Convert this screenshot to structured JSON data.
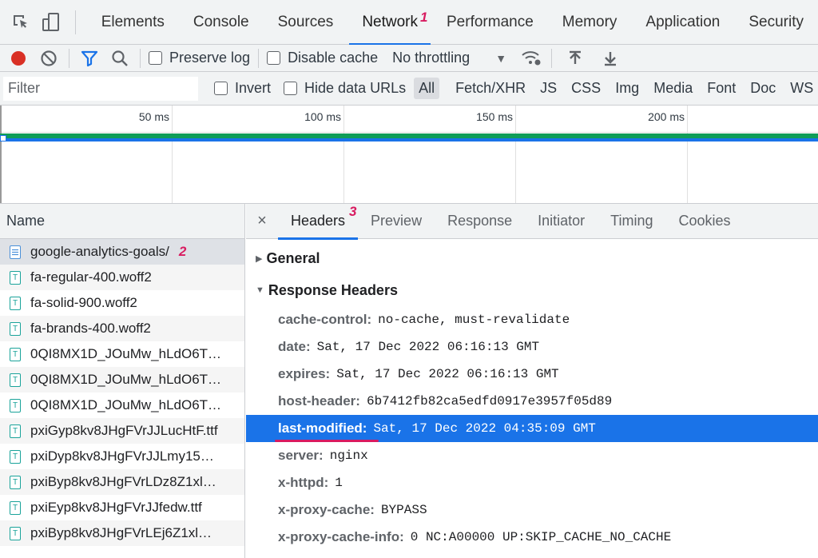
{
  "tabs": [
    {
      "label": "Elements"
    },
    {
      "label": "Console"
    },
    {
      "label": "Sources"
    },
    {
      "label": "Network",
      "active": true
    },
    {
      "label": "Performance"
    },
    {
      "label": "Memory"
    },
    {
      "label": "Application"
    },
    {
      "label": "Security"
    }
  ],
  "annotations": {
    "one": "1",
    "two": "2",
    "three": "3"
  },
  "toolbar": {
    "preserve_log": "Preserve log",
    "disable_cache": "Disable cache",
    "throttling": "No throttling"
  },
  "filterbar": {
    "placeholder": "Filter",
    "invert": "Invert",
    "hide_data_urls": "Hide data URLs",
    "types": [
      "All",
      "Fetch/XHR",
      "JS",
      "CSS",
      "Img",
      "Media",
      "Font",
      "Doc",
      "WS"
    ]
  },
  "timeline": {
    "ticks": [
      "50 ms",
      "100 ms",
      "150 ms",
      "200 ms"
    ]
  },
  "requests": {
    "header": "Name",
    "items": [
      {
        "name": "google-analytics-goals/",
        "type": "doc"
      },
      {
        "name": "fa-regular-400.woff2",
        "type": "font"
      },
      {
        "name": "fa-solid-900.woff2",
        "type": "font"
      },
      {
        "name": "fa-brands-400.woff2",
        "type": "font"
      },
      {
        "name": "0QI8MX1D_JOuMw_hLdO6T…",
        "type": "font"
      },
      {
        "name": "0QI8MX1D_JOuMw_hLdO6T…",
        "type": "font"
      },
      {
        "name": "0QI8MX1D_JOuMw_hLdO6T…",
        "type": "font"
      },
      {
        "name": "pxiGyp8kv8JHgFVrJJLucHtF.ttf",
        "type": "font"
      },
      {
        "name": "pxiDyp8kv8JHgFVrJJLmy15…",
        "type": "font"
      },
      {
        "name": "pxiByp8kv8JHgFVrLDz8Z1xl…",
        "type": "font"
      },
      {
        "name": "pxiEyp8kv8JHgFVrJJfedw.ttf",
        "type": "font"
      },
      {
        "name": "pxiByp8kv8JHgFVrLEj6Z1xl…",
        "type": "font"
      }
    ]
  },
  "detail": {
    "close": "×",
    "tabs": [
      "Headers",
      "Preview",
      "Response",
      "Initiator",
      "Timing",
      "Cookies"
    ],
    "general": "General",
    "response_headers": "Response Headers",
    "headers": [
      {
        "key": "cache-control:",
        "value": "no-cache, must-revalidate"
      },
      {
        "key": "date:",
        "value": "Sat, 17 Dec 2022 06:16:13 GMT"
      },
      {
        "key": "expires:",
        "value": "Sat, 17 Dec 2022 06:16:13 GMT"
      },
      {
        "key": "host-header:",
        "value": "6b7412fb82ca5edfd0917e3957f05d89"
      },
      {
        "key": "last-modified:",
        "value": "Sat, 17 Dec 2022 04:35:09 GMT",
        "highlight": true
      },
      {
        "key": "server:",
        "value": "nginx"
      },
      {
        "key": "x-httpd:",
        "value": "1"
      },
      {
        "key": "x-proxy-cache:",
        "value": "BYPASS"
      },
      {
        "key": "x-proxy-cache-info:",
        "value": "0 NC:A00000 UP:SKIP_CACHE_NO_CACHE"
      }
    ]
  },
  "colors": {
    "accent": "#1a73e8",
    "record": "#d93025",
    "annotation": "#d81b60",
    "timeline_green": "#0f9d58"
  }
}
